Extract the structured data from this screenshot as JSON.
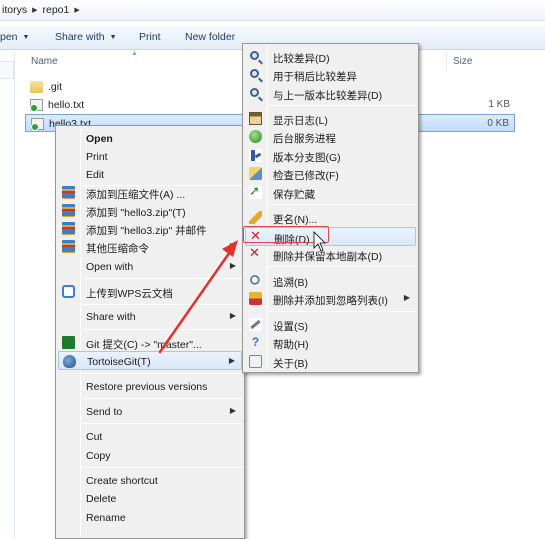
{
  "breadcrumb": {
    "items": [
      "itorys",
      "repo1"
    ]
  },
  "toolbar": {
    "open_label": "pen",
    "share_label": "Share with",
    "print_label": "Print",
    "new_folder_label": "New folder"
  },
  "columns": {
    "name": "Name",
    "size": "Size"
  },
  "files": [
    {
      "name": ".git",
      "size": "",
      "icon": "folder-icon"
    },
    {
      "name": "hello.txt",
      "size": "1 KB",
      "icon": "git-file-icon"
    },
    {
      "name": "hello3.txt",
      "size": "0 KB",
      "icon": "git-file-icon"
    }
  ],
  "context_menu": {
    "items": [
      {
        "label": "Open",
        "bold": true
      },
      {
        "label": "Print"
      },
      {
        "label": "Edit"
      },
      {
        "label": "添加到压缩文件(A) ...",
        "icon": "archive-icon"
      },
      {
        "label": "添加到 \"hello3.zip\"(T)",
        "icon": "archive-icon"
      },
      {
        "label": "添加到 \"hello3.zip\" 并邮件",
        "icon": "archive-icon"
      },
      {
        "label": "其他压缩命令",
        "icon": "archive-icon",
        "submenu": true
      },
      {
        "label": "Open with",
        "submenu": true
      },
      {
        "label": "上传到WPS云文档",
        "icon": "cloud-upload-icon"
      },
      {
        "label": "Share with",
        "submenu": true
      },
      {
        "label": "Git 提交(C) -> \"master\"...",
        "icon": "git-commit-icon"
      },
      {
        "label": "TortoiseGit(T)",
        "icon": "tortoisegit-icon",
        "submenu": true
      },
      {
        "label": "Restore previous versions"
      },
      {
        "label": "Send to",
        "submenu": true
      },
      {
        "label": "Cut"
      },
      {
        "label": "Copy"
      },
      {
        "label": "Create shortcut"
      },
      {
        "label": "Delete"
      },
      {
        "label": "Rename"
      }
    ]
  },
  "tortoise_menu": {
    "items": [
      {
        "label": "比较差异(D)",
        "icon": "diff-magnifier-icon"
      },
      {
        "label": "用于稍后比较差异",
        "icon": "diff-later-icon"
      },
      {
        "label": "与上一版本比较差异(D)",
        "icon": "diff-previous-icon"
      },
      {
        "label": "显示日志(L)",
        "icon": "log-icon"
      },
      {
        "label": "后台服务进程",
        "icon": "daemon-icon"
      },
      {
        "label": "版本分支图(G)",
        "icon": "revision-graph-icon"
      },
      {
        "label": "检查已修改(F)",
        "icon": "check-modifications-icon"
      },
      {
        "label": "保存贮藏",
        "icon": "stash-save-icon"
      },
      {
        "label": "更名(N)...",
        "icon": "rename-icon"
      },
      {
        "label": "删除(D)",
        "icon": "delete-icon"
      },
      {
        "label": "删除并保留本地副本(D)",
        "icon": "delete-keep-local-icon"
      },
      {
        "label": "追溯(B)",
        "icon": "blame-icon"
      },
      {
        "label": "删除并添加到忽略列表(I)",
        "icon": "ignore-icon",
        "submenu": true
      },
      {
        "label": "设置(S)",
        "icon": "settings-icon"
      },
      {
        "label": "帮助(H)",
        "icon": "help-icon"
      },
      {
        "label": "关于(B)",
        "icon": "about-icon"
      }
    ]
  },
  "colors": {
    "annotation_red": "#e3312f",
    "selection": "#c1dcfc"
  }
}
